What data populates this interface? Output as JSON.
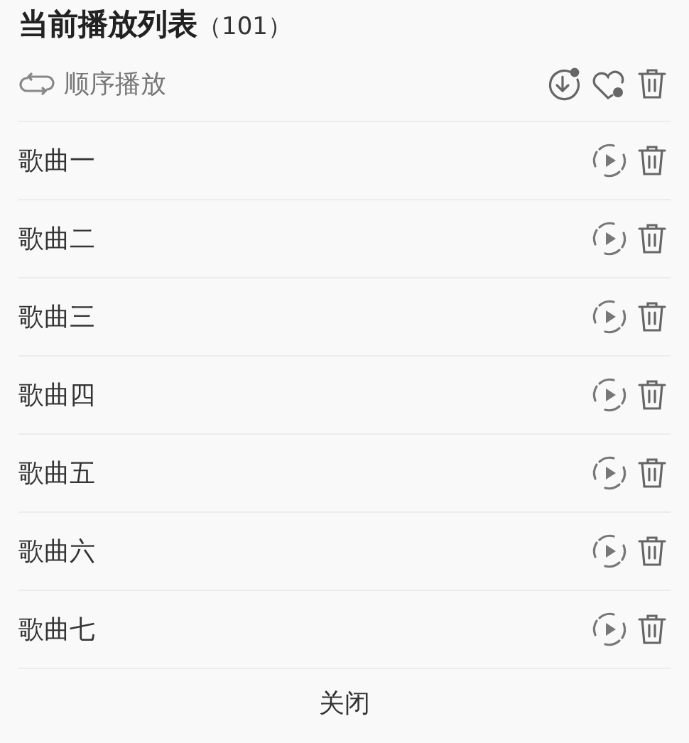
{
  "title": "当前播放列表",
  "count": "（101）",
  "play_mode": {
    "label": "顺序播放"
  },
  "songs": [
    {
      "name": "歌曲一"
    },
    {
      "name": "歌曲二"
    },
    {
      "name": "歌曲三"
    },
    {
      "name": "歌曲四"
    },
    {
      "name": "歌曲五"
    },
    {
      "name": "歌曲六"
    },
    {
      "name": "歌曲七"
    }
  ],
  "close_button": "关闭"
}
